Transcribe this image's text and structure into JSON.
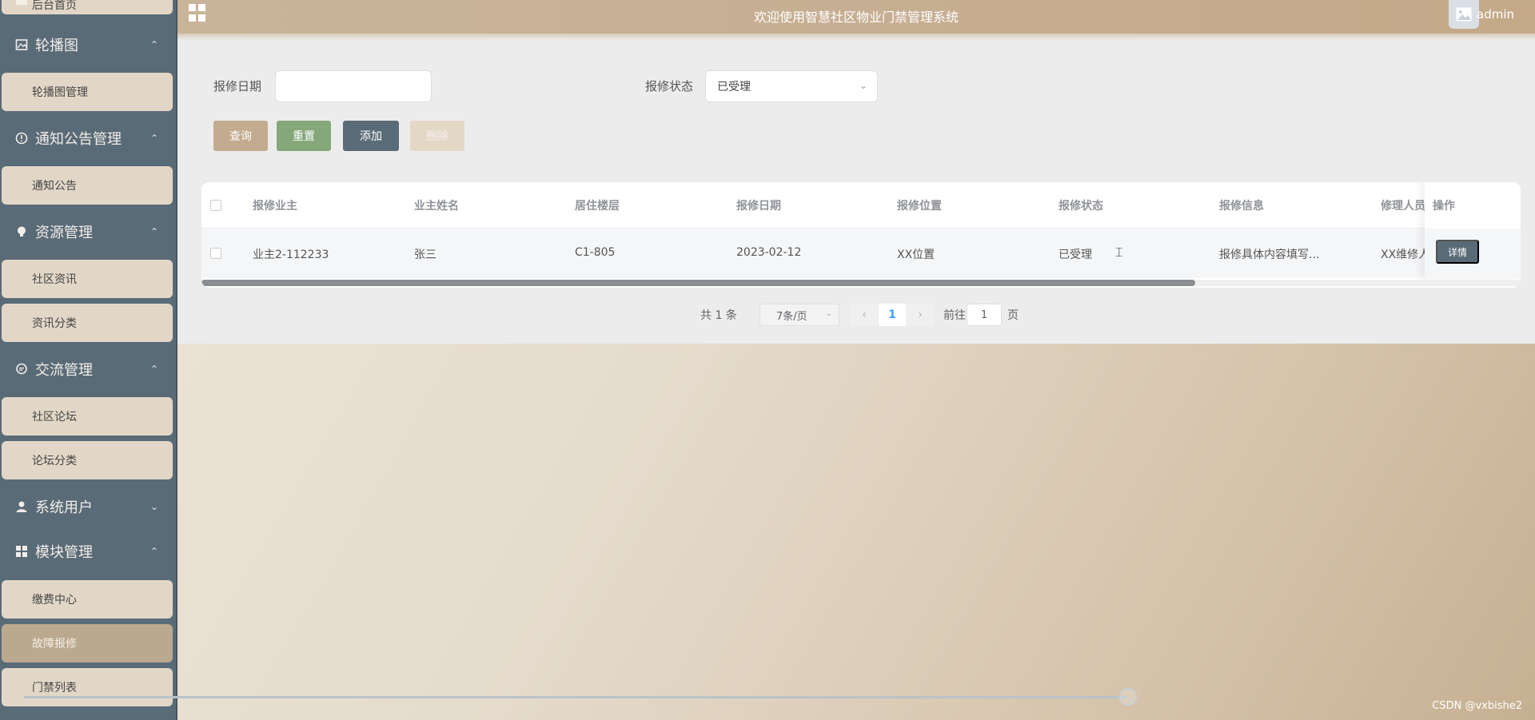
{
  "header": {
    "title": "欢迎使用智慧社区物业门禁管理系统",
    "username": "admin"
  },
  "sidebar": {
    "top_partial": "后台首页",
    "groups": [
      {
        "label": "轮播图",
        "chevron": "^",
        "items": [
          "轮播图管理"
        ]
      },
      {
        "label": "通知公告管理",
        "chevron": "^",
        "items": [
          "通知公告"
        ]
      },
      {
        "label": "资源管理",
        "chevron": "^",
        "items": [
          "社区资讯",
          "资讯分类"
        ]
      },
      {
        "label": "交流管理",
        "chevron": "^",
        "items": [
          "社区论坛",
          "论坛分类"
        ]
      },
      {
        "label": "系统用户",
        "chevron": "v",
        "items": []
      },
      {
        "label": "模块管理",
        "chevron": "^",
        "items": [
          "缴费中心",
          "故障报修",
          "门禁列表"
        ]
      }
    ],
    "active_item": "故障报修"
  },
  "filters": {
    "date_label": "报修日期",
    "date_value": "",
    "status_label": "报修状态",
    "status_value": "已受理"
  },
  "buttons": {
    "query": "查询",
    "reset": "重置",
    "add": "添加",
    "delete": "删除"
  },
  "table": {
    "headers": [
      "报修业主",
      "业主姓名",
      "居住楼层",
      "报修日期",
      "报修位置",
      "报修状态",
      "报修信息",
      "修理人员",
      "操作"
    ],
    "rows": [
      [
        "业主2-112233",
        "张三",
        "C1-805",
        "2023-02-12",
        "XX位置",
        "已受理",
        "报修具体内容填写...",
        "XX维修人员"
      ]
    ],
    "row_action": "详情"
  },
  "pagination": {
    "total": "共 1 条",
    "page_size": "7条/页",
    "current_page": "1",
    "goto_label": "前往",
    "goto_value": "1",
    "page_suffix": "页"
  },
  "player": {
    "progress": 0.75
  },
  "watermark": "CSDN @vxbishe2"
}
